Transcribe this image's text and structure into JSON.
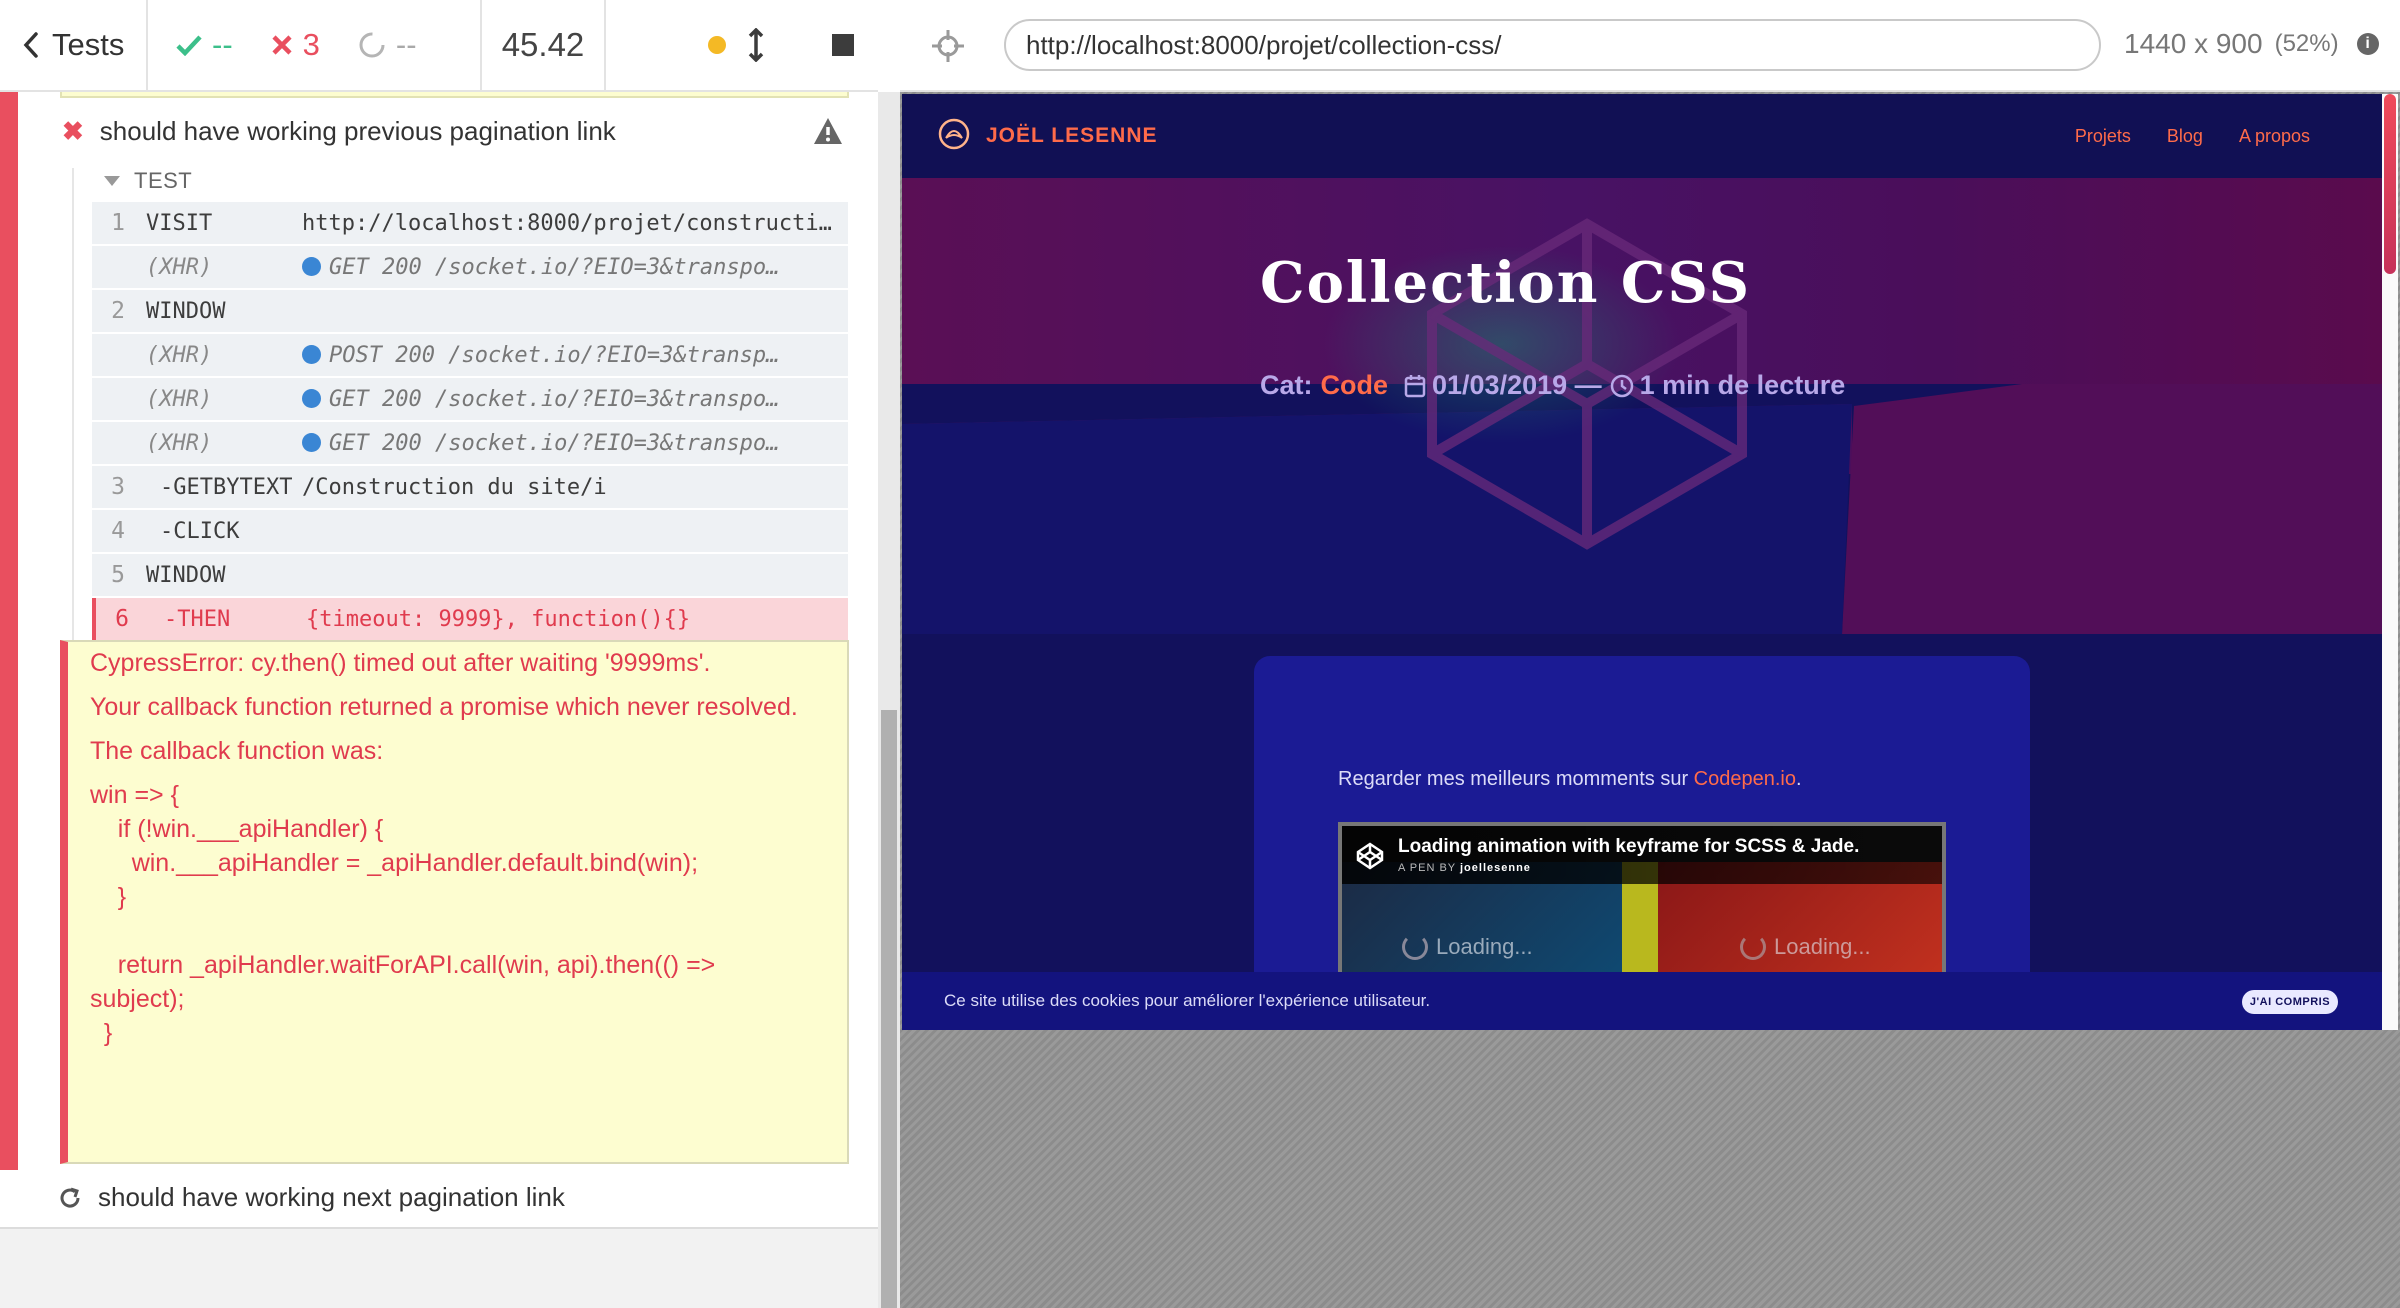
{
  "reporter": {
    "back_label": "Tests",
    "stats": {
      "passed": "--",
      "failed": "3",
      "pending": "--"
    },
    "duration": "45.42",
    "failed_test_title": "should have working previous pagination link",
    "hook_label": "TEST",
    "commands": [
      {
        "num": "1",
        "name": "VISIT",
        "message": "http://localhost:8000/projet/construction…",
        "kind": "normal"
      },
      {
        "num": "",
        "name": "(XHR)",
        "message": "GET 200 /socket.io/?EIO=3&transpo…",
        "kind": "xhr"
      },
      {
        "num": "2",
        "name": "WINDOW",
        "message": "",
        "kind": "normal"
      },
      {
        "num": "",
        "name": "(XHR)",
        "message": "POST 200 /socket.io/?EIO=3&transp…",
        "kind": "xhr"
      },
      {
        "num": "",
        "name": "(XHR)",
        "message": "GET 200 /socket.io/?EIO=3&transpo…",
        "kind": "xhr"
      },
      {
        "num": "",
        "name": "(XHR)",
        "message": "GET 200 /socket.io/?EIO=3&transpo…",
        "kind": "xhr"
      },
      {
        "num": "3",
        "name": "-GETBYTEXT",
        "message": "/Construction du site/i",
        "kind": "child"
      },
      {
        "num": "4",
        "name": "-CLICK",
        "message": "",
        "kind": "child"
      },
      {
        "num": "5",
        "name": "WINDOW",
        "message": "",
        "kind": "normal"
      },
      {
        "num": "6",
        "name": "-THEN",
        "message": "{timeout: 9999}, function(){}",
        "kind": "error"
      }
    ],
    "error": {
      "line1": "CypressError: cy.then() timed out after waiting '9999ms'.",
      "line2": "Your callback function returned a promise which never resolved.",
      "line3": "The callback function was:",
      "code": "win => {\n    if (!win.___apiHandler) {\n      win.___apiHandler = _apiHandler.default.bind(win);\n    }\n\n    return _apiHandler.waitForAPI.call(win, api).then(() =>\nsubject);\n  }"
    },
    "next_test_title": "should have working next pagination link"
  },
  "aut": {
    "url": "http://localhost:8000/projet/collection-css/",
    "viewport": "1440 x 900",
    "scale": "(52%)",
    "info_icon": "i",
    "site": {
      "brand": "JOËL LESENNE",
      "nav": [
        "Projets",
        "Blog",
        "A propos"
      ],
      "title": "Collection CSS",
      "cat_label": "Cat:",
      "cat_value": "Code",
      "date": "01/03/2019 —",
      "read_time": "1 min de lecture",
      "intro_text": "Regarder mes meilleurs momments sur ",
      "intro_link": "Codepen.io",
      "intro_end": ".",
      "pen_title": "Loading animation with keyframe for SCSS & Jade.",
      "pen_by": "A PEN BY ",
      "pen_author": "joellesenne",
      "loading_left": "Loading...",
      "loading_right": "Loading...",
      "cookie_text": "Ce site utilise des cookies pour améliorer l'expérience utilisateur.",
      "cookie_button": "J'AI COMPRIS"
    }
  },
  "colors": {
    "fail": "#e94f5f",
    "pass": "#3cbf8a",
    "accent": "#ff6b4a",
    "site_bg": "#12115c"
  }
}
